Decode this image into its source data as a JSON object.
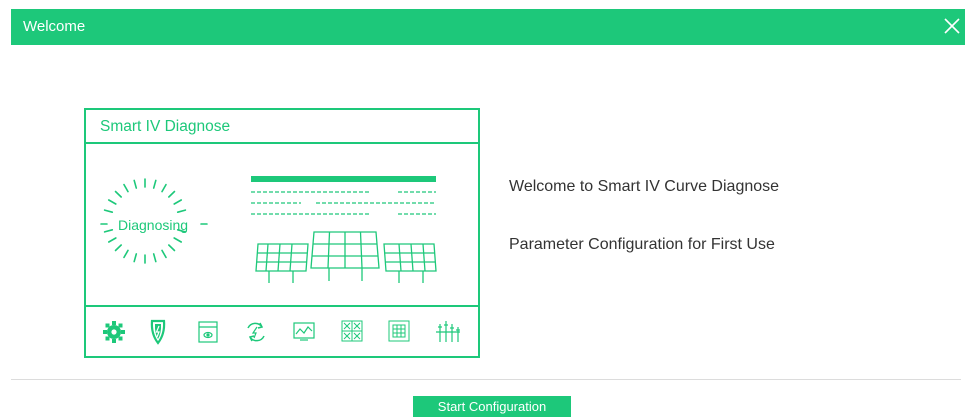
{
  "window": {
    "title": "Welcome"
  },
  "illustration": {
    "panel_title": "Smart IV Diagnose",
    "status_label": "Diagnosing",
    "icons": [
      "gear-icon",
      "shield-icon",
      "window-eye-icon",
      "refresh-icon",
      "chart-icon",
      "grid-x-icon",
      "grid-icon",
      "sliders-icon"
    ]
  },
  "main": {
    "welcome_text": "Welcome to Smart IV Curve Diagnose",
    "parameter_text": "Parameter Configuration for First Use"
  },
  "footer": {
    "start_label": "Start Configuration"
  },
  "colors": {
    "accent": "#1dc87a",
    "text": "#333333",
    "divider": "#dcdcdc"
  }
}
